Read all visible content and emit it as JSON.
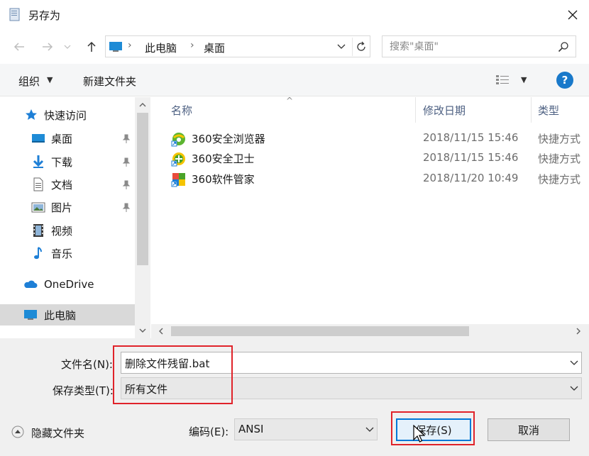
{
  "title": "另存为",
  "addr": {
    "crumbs": [
      "此电脑",
      "桌面"
    ],
    "search_placeholder": "搜索\"桌面\""
  },
  "toolbar": {
    "organize": "组织",
    "new_folder": "新建文件夹"
  },
  "sidebar": {
    "items": [
      {
        "label": "快速访问",
        "icon": "star-icon"
      },
      {
        "label": "桌面",
        "icon": "desktop-icon",
        "pinned": true
      },
      {
        "label": "下载",
        "icon": "download-icon",
        "pinned": true
      },
      {
        "label": "文档",
        "icon": "document-icon",
        "pinned": true
      },
      {
        "label": "图片",
        "icon": "picture-icon",
        "pinned": true
      },
      {
        "label": "视频",
        "icon": "video-icon"
      },
      {
        "label": "音乐",
        "icon": "music-icon"
      },
      {
        "label": "OneDrive",
        "icon": "cloud-icon"
      },
      {
        "label": "此电脑",
        "icon": "computer-icon",
        "selected": true
      }
    ]
  },
  "columns": {
    "name": "名称",
    "date": "修改日期",
    "type": "类型"
  },
  "files": [
    {
      "name": "360安全浏览器",
      "date": "2018/11/15 15:46",
      "type": "快捷方式",
      "icon": "browser-360-icon"
    },
    {
      "name": "360安全卫士",
      "date": "2018/11/15 15:46",
      "type": "快捷方式",
      "icon": "safeguard-360-icon"
    },
    {
      "name": "360软件管家",
      "date": "2018/11/20 10:49",
      "type": "快捷方式",
      "icon": "softmgr-360-icon"
    }
  ],
  "form": {
    "filename_label": "文件名(N):",
    "filename_value": "删除文件残留.bat",
    "filetype_label": "保存类型(T):",
    "filetype_value": "所有文件",
    "encoding_label": "编码(E):",
    "encoding_value": "ANSI",
    "hide_folders": "隐藏文件夹",
    "save": "保存(S)",
    "cancel": "取消"
  },
  "colors": {
    "accent": "#0078d7",
    "highlight": "#e0232a",
    "selected": "#d9d9d9"
  }
}
